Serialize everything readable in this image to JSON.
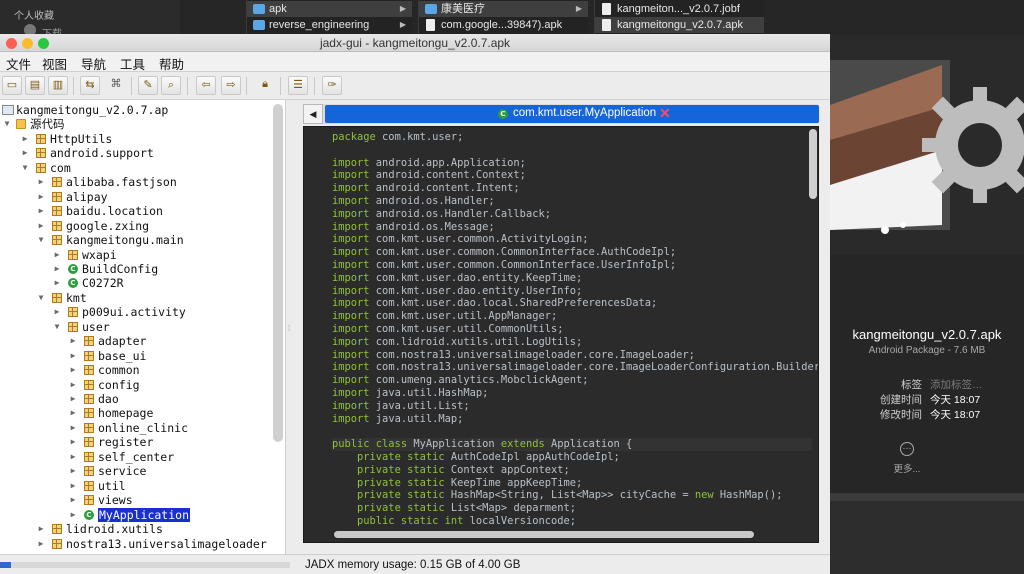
{
  "finder": {
    "sidebar": {
      "favorites_label": "个人收藏",
      "downloads_label": "下载"
    },
    "columns": [
      {
        "items": [
          {
            "name": "apk",
            "kind": "folder",
            "selected": true
          },
          {
            "name": "reverse_engineering",
            "kind": "folder",
            "selected": false
          }
        ]
      },
      {
        "items": [
          {
            "name": "康美医疗",
            "kind": "folder",
            "selected": true
          },
          {
            "name": "com.google...39847).apk",
            "kind": "apk",
            "selected": false
          }
        ]
      },
      {
        "items": [
          {
            "name": "kangmeiton..._v2.0.7.jobf",
            "kind": "doc",
            "selected": false
          },
          {
            "name": "kangmeitongu_v2.0.7.apk",
            "kind": "apk",
            "selected": true
          }
        ]
      }
    ],
    "preview": {
      "file_name": "kangmeitongu_v2.0.7.apk",
      "kind": "Android Package - 7.6 MB",
      "tags_label": "标签",
      "tags_placeholder": "添加标签…",
      "created_label": "创建时间",
      "created_value": "今天 18:07",
      "modified_label": "修改时间",
      "modified_value": "今天 18:07",
      "more_label": "更多..."
    }
  },
  "jadx": {
    "title": "jadx-gui - kangmeitongu_v2.0.7.apk",
    "menu": [
      "文件",
      "视图",
      "导航",
      "工具",
      "帮助"
    ],
    "tree": [
      {
        "label": "kangmeitongu_v2.0.7.ap",
        "icon": "apk",
        "depth": 0,
        "exp": ""
      },
      {
        "label": "源代码",
        "icon": "folder",
        "depth": 0,
        "exp": "open"
      },
      {
        "label": "HttpUtils",
        "icon": "pkg",
        "depth": 1,
        "exp": "closed"
      },
      {
        "label": "android.support",
        "icon": "pkg",
        "depth": 1,
        "exp": "closed"
      },
      {
        "label": "com",
        "icon": "pkg",
        "depth": 1,
        "exp": "open"
      },
      {
        "label": "alibaba.fastjson",
        "icon": "pkg",
        "depth": 2,
        "exp": "closed"
      },
      {
        "label": "alipay",
        "icon": "pkg",
        "depth": 2,
        "exp": "closed"
      },
      {
        "label": "baidu.location",
        "icon": "pkg",
        "depth": 2,
        "exp": "closed"
      },
      {
        "label": "google.zxing",
        "icon": "pkg",
        "depth": 2,
        "exp": "closed"
      },
      {
        "label": "kangmeitongu.main",
        "icon": "pkg",
        "depth": 2,
        "exp": "open"
      },
      {
        "label": "wxapi",
        "icon": "pkg",
        "depth": 3,
        "exp": "closed"
      },
      {
        "label": "BuildConfig",
        "icon": "class",
        "depth": 3,
        "exp": "closed"
      },
      {
        "label": "C0272R",
        "icon": "class",
        "depth": 3,
        "exp": "closed"
      },
      {
        "label": "kmt",
        "icon": "pkg",
        "depth": 2,
        "exp": "open"
      },
      {
        "label": "p009ui.activity",
        "icon": "pkg",
        "depth": 3,
        "exp": "closed"
      },
      {
        "label": "user",
        "icon": "pkg",
        "depth": 3,
        "exp": "open"
      },
      {
        "label": "adapter",
        "icon": "pkg",
        "depth": 4,
        "exp": "closed"
      },
      {
        "label": "base_ui",
        "icon": "pkg",
        "depth": 4,
        "exp": "closed"
      },
      {
        "label": "common",
        "icon": "pkg",
        "depth": 4,
        "exp": "closed"
      },
      {
        "label": "config",
        "icon": "pkg",
        "depth": 4,
        "exp": "closed"
      },
      {
        "label": "dao",
        "icon": "pkg",
        "depth": 4,
        "exp": "closed"
      },
      {
        "label": "homepage",
        "icon": "pkg",
        "depth": 4,
        "exp": "closed"
      },
      {
        "label": "online_clinic",
        "icon": "pkg",
        "depth": 4,
        "exp": "closed"
      },
      {
        "label": "register",
        "icon": "pkg",
        "depth": 4,
        "exp": "closed"
      },
      {
        "label": "self_center",
        "icon": "pkg",
        "depth": 4,
        "exp": "closed"
      },
      {
        "label": "service",
        "icon": "pkg",
        "depth": 4,
        "exp": "closed"
      },
      {
        "label": "util",
        "icon": "pkg",
        "depth": 4,
        "exp": "closed"
      },
      {
        "label": "views",
        "icon": "pkg",
        "depth": 4,
        "exp": "closed"
      },
      {
        "label": "MyApplication",
        "icon": "class",
        "depth": 4,
        "exp": "closed",
        "selected": true
      },
      {
        "label": "lidroid.xutils",
        "icon": "pkg",
        "depth": 2,
        "exp": "closed"
      },
      {
        "label": "nostra13.universalimageloader",
        "icon": "pkg",
        "depth": 2,
        "exp": "closed"
      }
    ],
    "tab": {
      "label": "com.kmt.user.MyApplication"
    },
    "code": [
      [
        [
          "kw",
          "package"
        ],
        [
          "tx",
          " com.kmt.user;"
        ]
      ],
      [],
      [
        [
          "kw",
          "import"
        ],
        [
          "tx",
          " android.app.Application;"
        ]
      ],
      [
        [
          "kw",
          "import"
        ],
        [
          "tx",
          " android.content.Context;"
        ]
      ],
      [
        [
          "kw",
          "import"
        ],
        [
          "tx",
          " android.content.Intent;"
        ]
      ],
      [
        [
          "kw",
          "import"
        ],
        [
          "tx",
          " android.os.Handler;"
        ]
      ],
      [
        [
          "kw",
          "import"
        ],
        [
          "tx",
          " android.os.Handler.Callback;"
        ]
      ],
      [
        [
          "kw",
          "import"
        ],
        [
          "tx",
          " android.os.Message;"
        ]
      ],
      [
        [
          "kw",
          "import"
        ],
        [
          "tx",
          " com.kmt.user.common.ActivityLogin;"
        ]
      ],
      [
        [
          "kw",
          "import"
        ],
        [
          "tx",
          " com.kmt.user.common.CommonInterface.AuthCodeIpl;"
        ]
      ],
      [
        [
          "kw",
          "import"
        ],
        [
          "tx",
          " com.kmt.user.common.CommonInterface.UserInfoIpl;"
        ]
      ],
      [
        [
          "kw",
          "import"
        ],
        [
          "tx",
          " com.kmt.user.dao.entity.KeepTime;"
        ]
      ],
      [
        [
          "kw",
          "import"
        ],
        [
          "tx",
          " com.kmt.user.dao.entity.UserInfo;"
        ]
      ],
      [
        [
          "kw",
          "import"
        ],
        [
          "tx",
          " com.kmt.user.dao.local.SharedPreferencesData;"
        ]
      ],
      [
        [
          "kw",
          "import"
        ],
        [
          "tx",
          " com.kmt.user.util.AppManager;"
        ]
      ],
      [
        [
          "kw",
          "import"
        ],
        [
          "tx",
          " com.kmt.user.util.CommonUtils;"
        ]
      ],
      [
        [
          "kw",
          "import"
        ],
        [
          "tx",
          " com.lidroid.xutils.util.LogUtils;"
        ]
      ],
      [
        [
          "kw",
          "import"
        ],
        [
          "tx",
          " com.nostra13.universalimageloader.core.ImageLoader;"
        ]
      ],
      [
        [
          "kw",
          "import"
        ],
        [
          "tx",
          " com.nostra13.universalimageloader.core.ImageLoaderConfiguration.Builder;"
        ]
      ],
      [
        [
          "kw",
          "import"
        ],
        [
          "tx",
          " com.umeng.analytics.MobclickAgent;"
        ]
      ],
      [
        [
          "kw",
          "import"
        ],
        [
          "tx",
          " java.util.HashMap;"
        ]
      ],
      [
        [
          "kw",
          "import"
        ],
        [
          "tx",
          " java.util.List;"
        ]
      ],
      [
        [
          "kw",
          "import"
        ],
        [
          "tx",
          " java.util.Map;"
        ]
      ],
      [],
      [
        [
          "kw",
          "public class"
        ],
        [
          "tx",
          " MyApplication "
        ],
        [
          "kw",
          "extends"
        ],
        [
          "tx",
          " Application {"
        ]
      ],
      [
        [
          "tx",
          "    "
        ],
        [
          "kw",
          "private static"
        ],
        [
          "tx",
          " AuthCodeIpl appAuthCodeIpl;"
        ]
      ],
      [
        [
          "tx",
          "    "
        ],
        [
          "kw",
          "private static"
        ],
        [
          "tx",
          " Context appContext;"
        ]
      ],
      [
        [
          "tx",
          "    "
        ],
        [
          "kw",
          "private static"
        ],
        [
          "tx",
          " KeepTime appKeepTime;"
        ]
      ],
      [
        [
          "tx",
          "    "
        ],
        [
          "kw",
          "private static"
        ],
        [
          "tx",
          " HashMap<String, List<Map>> cityCache = "
        ],
        [
          "kw",
          "new"
        ],
        [
          "tx",
          " HashMap();"
        ]
      ],
      [
        [
          "tx",
          "    "
        ],
        [
          "kw",
          "private static"
        ],
        [
          "tx",
          " List<Map> deparment;"
        ]
      ],
      [
        [
          "tx",
          "    "
        ],
        [
          "kw",
          "public static int"
        ],
        [
          "tx",
          " localVersioncode;"
        ]
      ]
    ],
    "status": {
      "memory_text": "JADX memory usage: 0.15 GB of 4.00 GB",
      "memory_fraction": 0.0375
    },
    "colors": {
      "accent": "#1565d8",
      "keyword": "#8fc23a",
      "code_bg": "#2b2b2b"
    }
  }
}
